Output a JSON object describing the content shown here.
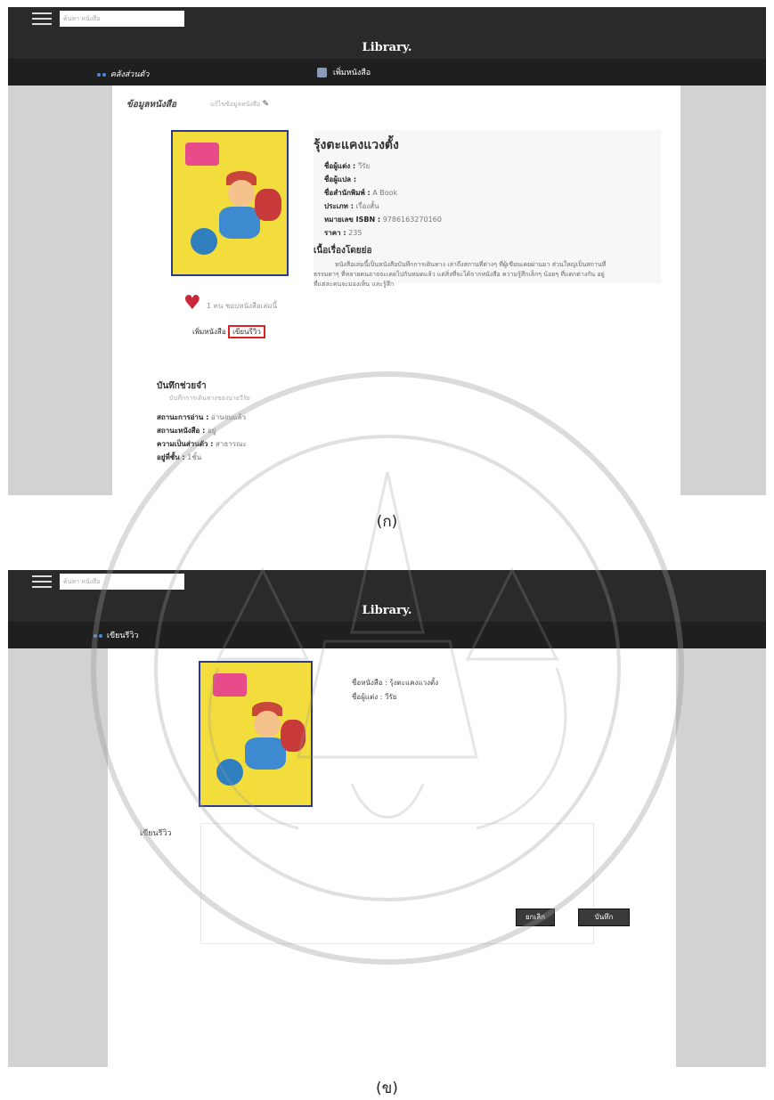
{
  "screen_a": {
    "search_placeholder": "ค้นหา หนังสือ",
    "app_title": "Library.",
    "nav_shelf": "คลังส่วนตัว",
    "nav_add": "เพิ่มหนังสือ",
    "section_title": "ข้อมูลหนังสือ",
    "edit_link": "แก้ไขข้อมูลหนังสือ",
    "book": {
      "title": "รุ้งตะแคงแวงตั้ง",
      "fields": [
        {
          "label": "ชื่อผู้แต่ง :",
          "value": "วีรัย"
        },
        {
          "label": "ชื่อผู้แปล :",
          "value": ""
        },
        {
          "label": "ชื่อสำนักพิมพ์ :",
          "value": "A Book"
        },
        {
          "label": "ประเภท :",
          "value": "เรื่องสั้น"
        },
        {
          "label": "หมายเลข ISBN :",
          "value": "9786163270160"
        },
        {
          "label": "ราคา :",
          "value": "235"
        }
      ],
      "synopsis_heading": "เนื้อเรื่องโดยย่อ",
      "synopsis": "หนังสือเล่มนี้เป็นหนังสือบันทึกการเดินทาง เล่าถึงสถานที่ต่างๆ ที่ผู้เขียนเคยผ่านมา ส่วนใหญ่เป็นสถานที่ธรรมดาๆ ที่หลายคนอาจจะเคยไปกันหมดแล้ว แต่สิ่งที่จะได้จากหนังสือ ความรู้สึกเล็กๆ น้อยๆ ที่แตกต่างกัน อยู่ที่แต่ละคนจะมองเห็น และรู้สึก"
    },
    "likes_text": "1 คน ชอบหนังสือเล่มนี้",
    "add_book_btn": "เพิ่มหนังสือ",
    "write_review_btn": "เขียนรีวิว",
    "memo_heading": "บันทึกช่วยจำ",
    "memo_sub": "บันทึกการเดินทางของนายวีรัย",
    "status": [
      {
        "label": "สถานะการอ่าน :",
        "value": "อ่านจบแล้ว"
      },
      {
        "label": "สถานะหนังสือ :",
        "value": "อยู่"
      },
      {
        "label": "ความเป็นส่วนตัว :",
        "value": "สาธารณะ"
      },
      {
        "label": "อยู่ที่ชั้น :",
        "value": "1ชั้น"
      }
    ]
  },
  "caption_a": "(ก)",
  "screen_b": {
    "search_placeholder": "ค้นหา หนังสือ",
    "app_title": "Library.",
    "nav_review": "เขียนรีวิว",
    "book_name_label": "ชื่อหนังสือ : รุ้งตะแคงแวงตั้ง",
    "author_label": "ชื่อผู้แต่ง : วีรัย",
    "review_label": "เขียนรีวิว",
    "cancel_btn": "ยกเลิก",
    "save_btn": "บันทึก"
  },
  "caption_b": "(ข)",
  "colors": {
    "topbar": "#2a2a2a",
    "cover": "#f2dd3c",
    "heart": "#c8283c",
    "highlight": "#dd2222"
  }
}
